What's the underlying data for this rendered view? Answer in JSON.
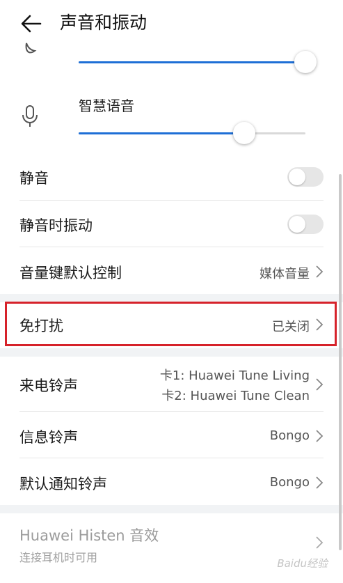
{
  "header": {
    "title": "声音和振动"
  },
  "sliders": [
    {
      "label": "",
      "icon": "bell-icon",
      "value": 1.0
    },
    {
      "label": "智慧语音",
      "icon": "microphone-icon",
      "value": 0.73
    }
  ],
  "toggles": {
    "mute": {
      "label": "静音",
      "on": false
    },
    "mute_vibrate": {
      "label": "静音时振动",
      "on": false
    }
  },
  "rows": {
    "volume_key": {
      "label": "音量键默认控制",
      "value": "媒体音量"
    },
    "dnd": {
      "label": "免打扰",
      "value": "已关闭"
    },
    "ringtone": {
      "label": "来电铃声",
      "value1": "卡1: Huawei Tune Living",
      "value2": "卡2: Huawei Tune Clean"
    },
    "message_tone": {
      "label": "信息铃声",
      "value": "Bongo"
    },
    "notification_tone": {
      "label": "默认通知铃声",
      "value": "Bongo"
    },
    "histen": {
      "label": "Huawei Histen 音效",
      "sub": "连接耳机时可用"
    }
  },
  "colors": {
    "accent": "#1e6fd6",
    "highlight": "#d6222a"
  },
  "watermark": "Baidu经验"
}
